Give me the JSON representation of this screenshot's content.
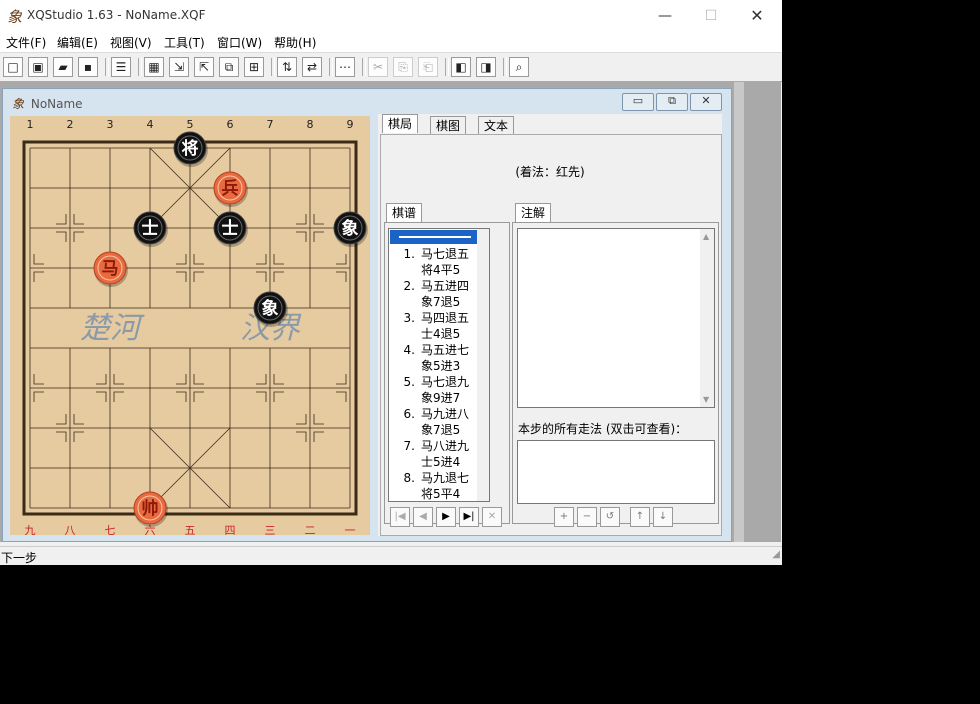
{
  "app": {
    "title": "XQStudio 1.63 - NoName.XQF",
    "icon": "象"
  },
  "menu": [
    "文件(F)",
    "编辑(E)",
    "视图(V)",
    "工具(T)",
    "窗口(W)",
    "帮助(H)"
  ],
  "toolbar": [
    {
      "name": "new-icon",
      "glyph": "□"
    },
    {
      "name": "open-template-icon",
      "glyph": "▣"
    },
    {
      "name": "open-folder-icon",
      "glyph": "▰"
    },
    {
      "name": "save-icon",
      "glyph": "▪"
    },
    {
      "name": "sep"
    },
    {
      "name": "list-icon",
      "glyph": "☰"
    },
    {
      "name": "sep"
    },
    {
      "name": "board-setup-icon",
      "glyph": "▦"
    },
    {
      "name": "export-icon",
      "glyph": "⇲"
    },
    {
      "name": "import-icon",
      "glyph": "⇱"
    },
    {
      "name": "copy-board-icon",
      "glyph": "⧉"
    },
    {
      "name": "paste-board-icon",
      "glyph": "⊞"
    },
    {
      "name": "sep"
    },
    {
      "name": "flip-vertical-icon",
      "glyph": "⇅"
    },
    {
      "name": "flip-horizontal-icon",
      "glyph": "⇄"
    },
    {
      "name": "sep"
    },
    {
      "name": "steps-icon",
      "glyph": "⋯"
    },
    {
      "name": "sep"
    },
    {
      "name": "cut-icon",
      "glyph": "✂",
      "disabled": true
    },
    {
      "name": "copy-icon",
      "glyph": "⎘",
      "disabled": true
    },
    {
      "name": "paste-icon",
      "glyph": "⎗",
      "disabled": true
    },
    {
      "name": "sep"
    },
    {
      "name": "page-prev-icon",
      "glyph": "◧"
    },
    {
      "name": "page-next-icon",
      "glyph": "◨"
    },
    {
      "name": "sep"
    },
    {
      "name": "print-preview-icon",
      "glyph": "⌕"
    }
  ],
  "child_window": {
    "title": "NoName",
    "icon": "象"
  },
  "board": {
    "top_labels": [
      "1",
      "2",
      "3",
      "4",
      "5",
      "6",
      "7",
      "8",
      "9"
    ],
    "bottom_labels": [
      "九",
      "八",
      "七",
      "六",
      "五",
      "四",
      "三",
      "二",
      "一"
    ],
    "river_left": "楚河",
    "river_right": "汉界",
    "pieces": [
      {
        "char": "将",
        "side": "black",
        "file": 4,
        "rank": 0
      },
      {
        "char": "兵",
        "side": "red",
        "file": 5,
        "rank": 1
      },
      {
        "char": "士",
        "side": "black",
        "file": 3,
        "rank": 2
      },
      {
        "char": "士",
        "side": "black",
        "file": 5,
        "rank": 2
      },
      {
        "char": "象",
        "side": "black",
        "file": 8,
        "rank": 2
      },
      {
        "char": "马",
        "side": "red",
        "file": 2,
        "rank": 3
      },
      {
        "char": "象",
        "side": "black",
        "file": 6,
        "rank": 4
      },
      {
        "char": "帅",
        "side": "red",
        "file": 3,
        "rank": 9
      }
    ],
    "colors": {
      "wood": "#e6cba0",
      "red_piece": "#e86a3e",
      "black_piece": "#111111",
      "line": "#3a2a18"
    }
  },
  "tabs": {
    "main": [
      "棋局",
      "棋图",
      "文本"
    ],
    "active": "棋局"
  },
  "move_info": "(着法：红先)",
  "record_tab": "棋谱",
  "comment_tab": "注解",
  "moves": [
    {
      "num": "1.",
      "red": "马七退五",
      "black": "将4平5"
    },
    {
      "num": "2.",
      "red": "马五进四",
      "black": "象7退5"
    },
    {
      "num": "3.",
      "red": "马四退五",
      "black": "士4退5"
    },
    {
      "num": "4.",
      "red": "马五进七",
      "black": "象5进3"
    },
    {
      "num": "5.",
      "red": "马七退九",
      "black": "象9进7"
    },
    {
      "num": "6.",
      "red": "马九进八",
      "black": "象7退5"
    },
    {
      "num": "7.",
      "red": "马八进九",
      "black": "士5进4"
    },
    {
      "num": "8.",
      "red": "马九退七",
      "black": "将5平4"
    }
  ],
  "all_moves_label": "本步的所有走法 (双击可查看)：",
  "nav_buttons": [
    "|◀",
    "◀",
    "▶",
    "▶|",
    "✕"
  ],
  "edit_buttons": [
    "+",
    "−",
    "↺",
    "↑",
    "↓"
  ],
  "status": "下一步"
}
